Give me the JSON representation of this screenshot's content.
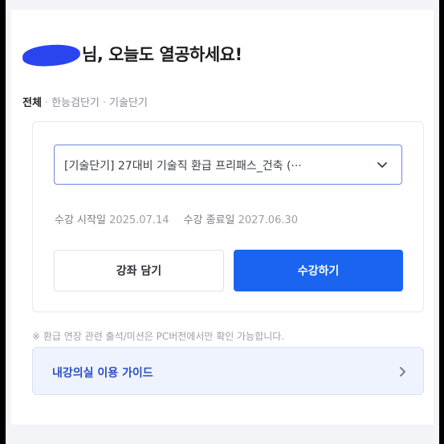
{
  "greeting": {
    "suffix": "님, 오늘도 열공하세요!"
  },
  "breadcrumb": {
    "items": [
      "전체",
      "한능검단기",
      "기술단기"
    ]
  },
  "course": {
    "selected": "[기술단기] 27대비 기술직 환급 프리패스_건축 (···",
    "start_label": "수강 시작일",
    "start_date": "2025.07.14",
    "end_label": "수강 종료일",
    "end_date": "2027.06.30"
  },
  "buttons": {
    "cart": "강좌 담기",
    "enroll": "수강하기"
  },
  "notice": "※ 환급 연장 관련 출석/미션은 PC버전에서만 확인 가능합니다.",
  "guide": {
    "label": "내강의실 이용 가이드"
  },
  "icons": {
    "dropdown": "chevron-down-icon",
    "guide_arrow": "chevron-right-icon"
  },
  "colors": {
    "primary": "#1a64f0",
    "guide_bg": "#eef3fd",
    "guide_text": "#2a4fc4",
    "redaction": "#2a45f0"
  }
}
